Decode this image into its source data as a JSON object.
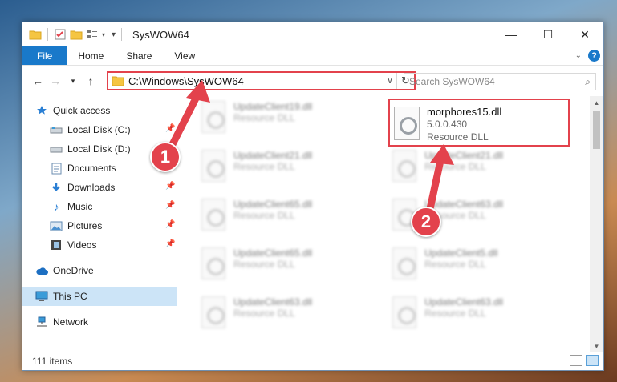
{
  "window": {
    "title": "SysWOW64"
  },
  "titlebar": {
    "minimize": "—",
    "maximize": "☐",
    "close": "✕"
  },
  "ribbon": {
    "tabs": [
      "File",
      "Home",
      "Share",
      "View"
    ]
  },
  "address": {
    "path": "C:\\Windows\\SysWOW64"
  },
  "search": {
    "placeholder": "Search SysWOW64"
  },
  "nav": {
    "quick_access": "Quick access",
    "quick_items": [
      {
        "label": "Local Disk (C:)",
        "icon": "drive-icon",
        "pinned": true
      },
      {
        "label": "Local Disk (D:)",
        "icon": "drive-icon",
        "pinned": false
      },
      {
        "label": "Documents",
        "icon": "documents-icon",
        "pinned": false
      },
      {
        "label": "Downloads",
        "icon": "download-icon",
        "pinned": true
      },
      {
        "label": "Music",
        "icon": "music-icon",
        "pinned": true
      },
      {
        "label": "Pictures",
        "icon": "pictures-icon",
        "pinned": true
      },
      {
        "label": "Videos",
        "icon": "videos-icon",
        "pinned": true
      }
    ],
    "onedrive": "OneDrive",
    "this_pc": "This PC",
    "network": "Network"
  },
  "files": {
    "highlighted": {
      "name": "morphores15.dll",
      "version": "5.0.0.430",
      "type": "Resource DLL"
    },
    "left_column": [
      {
        "name": "UpdateClient19.dll",
        "type": "Resource DLL"
      },
      {
        "name": "UpdateClient21.dll",
        "type": "Resource DLL"
      },
      {
        "name": "UpdateClient65.dll",
        "type": "Resource DLL"
      },
      {
        "name": "UpdateClient65.dll",
        "type": "Resource DLL"
      },
      {
        "name": "UpdateClient63.dll",
        "type": "Resource DLL"
      }
    ],
    "right_column": [
      {
        "name": "UpdateClient21.dll",
        "type": "Resource DLL"
      },
      {
        "name": "UpdateClient63.dll",
        "type": "Resource DLL"
      },
      {
        "name": "UpdateClient5.dll",
        "type": "Resource DLL"
      },
      {
        "name": "UpdateClient63.dll",
        "type": "Resource DLL"
      }
    ]
  },
  "status": {
    "count": "111 items"
  },
  "annotations": {
    "badge1": "1",
    "badge2": "2",
    "color": "#e3424c"
  }
}
